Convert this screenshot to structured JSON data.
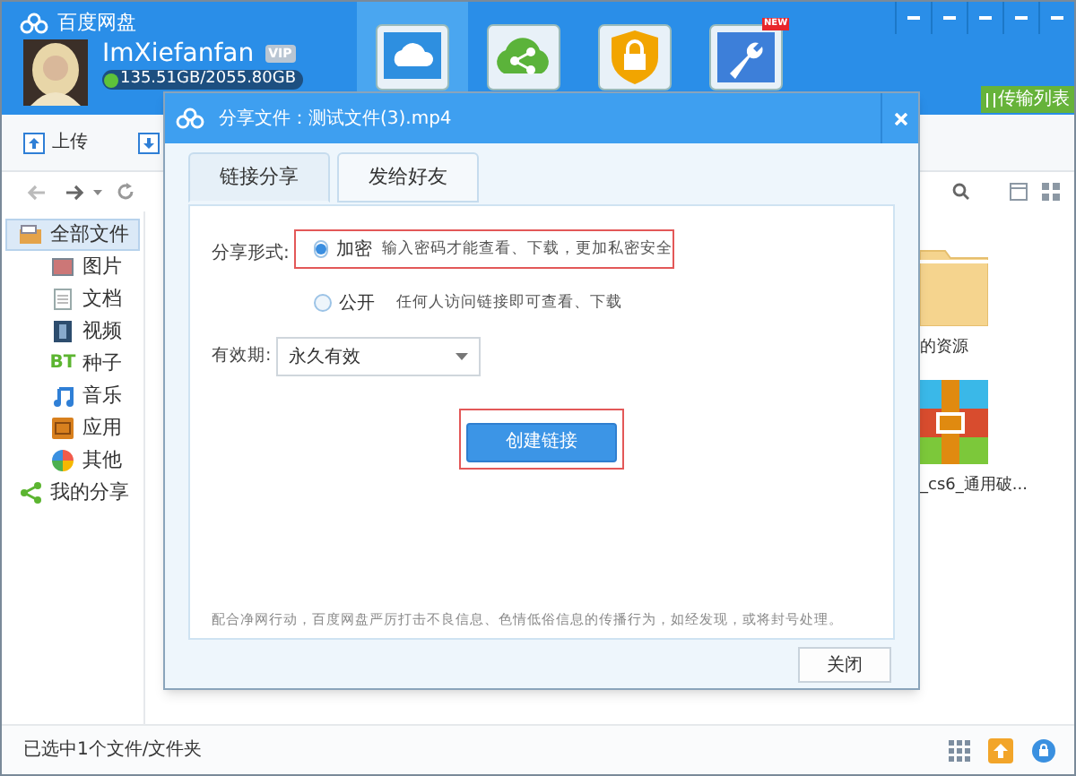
{
  "app": {
    "title": "百度网盘"
  },
  "user": {
    "name": "ImXiefanfan",
    "badge": "VIP",
    "quota": "135.51GB/2055.80GB"
  },
  "nav_tabs": [
    {
      "kind": "cloud",
      "selected": true
    },
    {
      "kind": "share",
      "selected": false
    },
    {
      "kind": "safe",
      "selected": false
    },
    {
      "kind": "tools",
      "selected": false,
      "badge": "NEW"
    }
  ],
  "transfer_button": "传输列表",
  "toolbar": {
    "upload": "上传"
  },
  "sidebar": [
    {
      "kind": "all",
      "label": "全部文件",
      "selected": true,
      "children": [
        {
          "kind": "image",
          "label": "图片",
          "selected": false
        },
        {
          "kind": "doc",
          "label": "文档",
          "selected": false
        },
        {
          "kind": "video",
          "label": "视频",
          "selected": false
        },
        {
          "kind": "bt",
          "label": "种子",
          "icon_text": "BT",
          "selected": false
        },
        {
          "kind": "music",
          "label": "音乐",
          "selected": false
        },
        {
          "kind": "app",
          "label": "应用",
          "selected": false
        },
        {
          "kind": "other",
          "label": "其他",
          "selected": false
        }
      ]
    },
    {
      "kind": "share",
      "label": "我的分享",
      "selected": false
    }
  ],
  "files": [
    {
      "kind": "folder",
      "name": "的资源"
    },
    {
      "kind": "archive",
      "name": "_cs6_通用破..."
    }
  ],
  "dialog": {
    "title": "分享文件：测试文件(3).mp4",
    "tabs": [
      {
        "label": "链接分享",
        "selected": true
      },
      {
        "label": "发给好友",
        "selected": false
      }
    ],
    "share_label": "分享形式:",
    "options": [
      {
        "label": "加密",
        "hint": "输入密码才能查看、下载，更加私密安全",
        "selected": true
      },
      {
        "label": "公开",
        "hint": "任何人访问链接即可查看、下载",
        "selected": false
      }
    ],
    "expiry_label": "有效期:",
    "expiry_value": "永久有效",
    "create_button": "创建链接",
    "notice": "配合净网行动，百度网盘严厉打击不良信息、色情低俗信息的传播行为，如经发现，或将封号处理。",
    "close_button": "关闭"
  },
  "status_bar": {
    "text": "已选中1个文件/文件夹"
  }
}
